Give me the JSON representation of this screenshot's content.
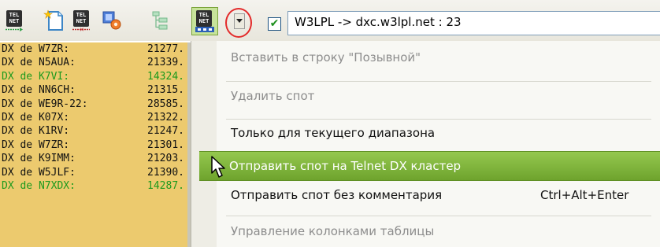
{
  "toolbar": {
    "buttons": [
      {
        "name": "telnet-connect",
        "text": "TEL NET"
      },
      {
        "name": "new-document",
        "text": ""
      },
      {
        "name": "telnet-disconnect",
        "text": "TEL NET"
      },
      {
        "name": "settings-tool",
        "text": ""
      },
      {
        "name": "tree-view",
        "text": ""
      },
      {
        "name": "telnet-active",
        "text": "TEL NET"
      }
    ],
    "dropdown_icon": "chevron-down-icon",
    "checkbox_checked": "✔",
    "server_value": "W3LPL -> dxc.w3lpl.net : 23"
  },
  "spots": [
    {
      "call": "DX de W7ZR:",
      "freq": "21277.",
      "color": "black"
    },
    {
      "call": "DX de N5AUA:",
      "freq": "21339.",
      "color": "black"
    },
    {
      "call": "DX de K7VI:",
      "freq": "14324.",
      "color": "green"
    },
    {
      "call": "DX de NN6CH:",
      "freq": "21315.",
      "color": "black"
    },
    {
      "call": "DX de WE9R-22:",
      "freq": "28585.",
      "color": "black"
    },
    {
      "call": "DX de K07X:",
      "freq": "21322.",
      "color": "black"
    },
    {
      "call": "DX de K1RV:",
      "freq": "21247.",
      "color": "black"
    },
    {
      "call": "DX de W7ZR:",
      "freq": "21301.",
      "color": "black"
    },
    {
      "call": "DX de K9IMM:",
      "freq": "21203.",
      "color": "black"
    },
    {
      "call": "DX de W5JLF:",
      "freq": "21390.",
      "color": "black"
    },
    {
      "call": "DX de N7XDX:",
      "freq": "14287.",
      "color": "green"
    }
  ],
  "menu": {
    "items": [
      {
        "label": "Вставить в строку \"Позывной\"",
        "enabled": false
      },
      {
        "label": "Удалить спот",
        "enabled": false
      },
      {
        "label": "Только для текущего диапазона",
        "enabled": true
      },
      {
        "label": "Отправить спот на Telnet DX кластер",
        "enabled": true,
        "highlighted": true
      },
      {
        "label": "Отправить спот без комментария",
        "enabled": true,
        "shortcut": "Ctrl+Alt+Enter"
      },
      {
        "label": "Управление колонками таблицы",
        "enabled": false
      }
    ]
  },
  "colors": {
    "accent_highlight": "#7cb342",
    "spots_background": "#ecca6e",
    "focus_ring": "#e32a2a"
  }
}
